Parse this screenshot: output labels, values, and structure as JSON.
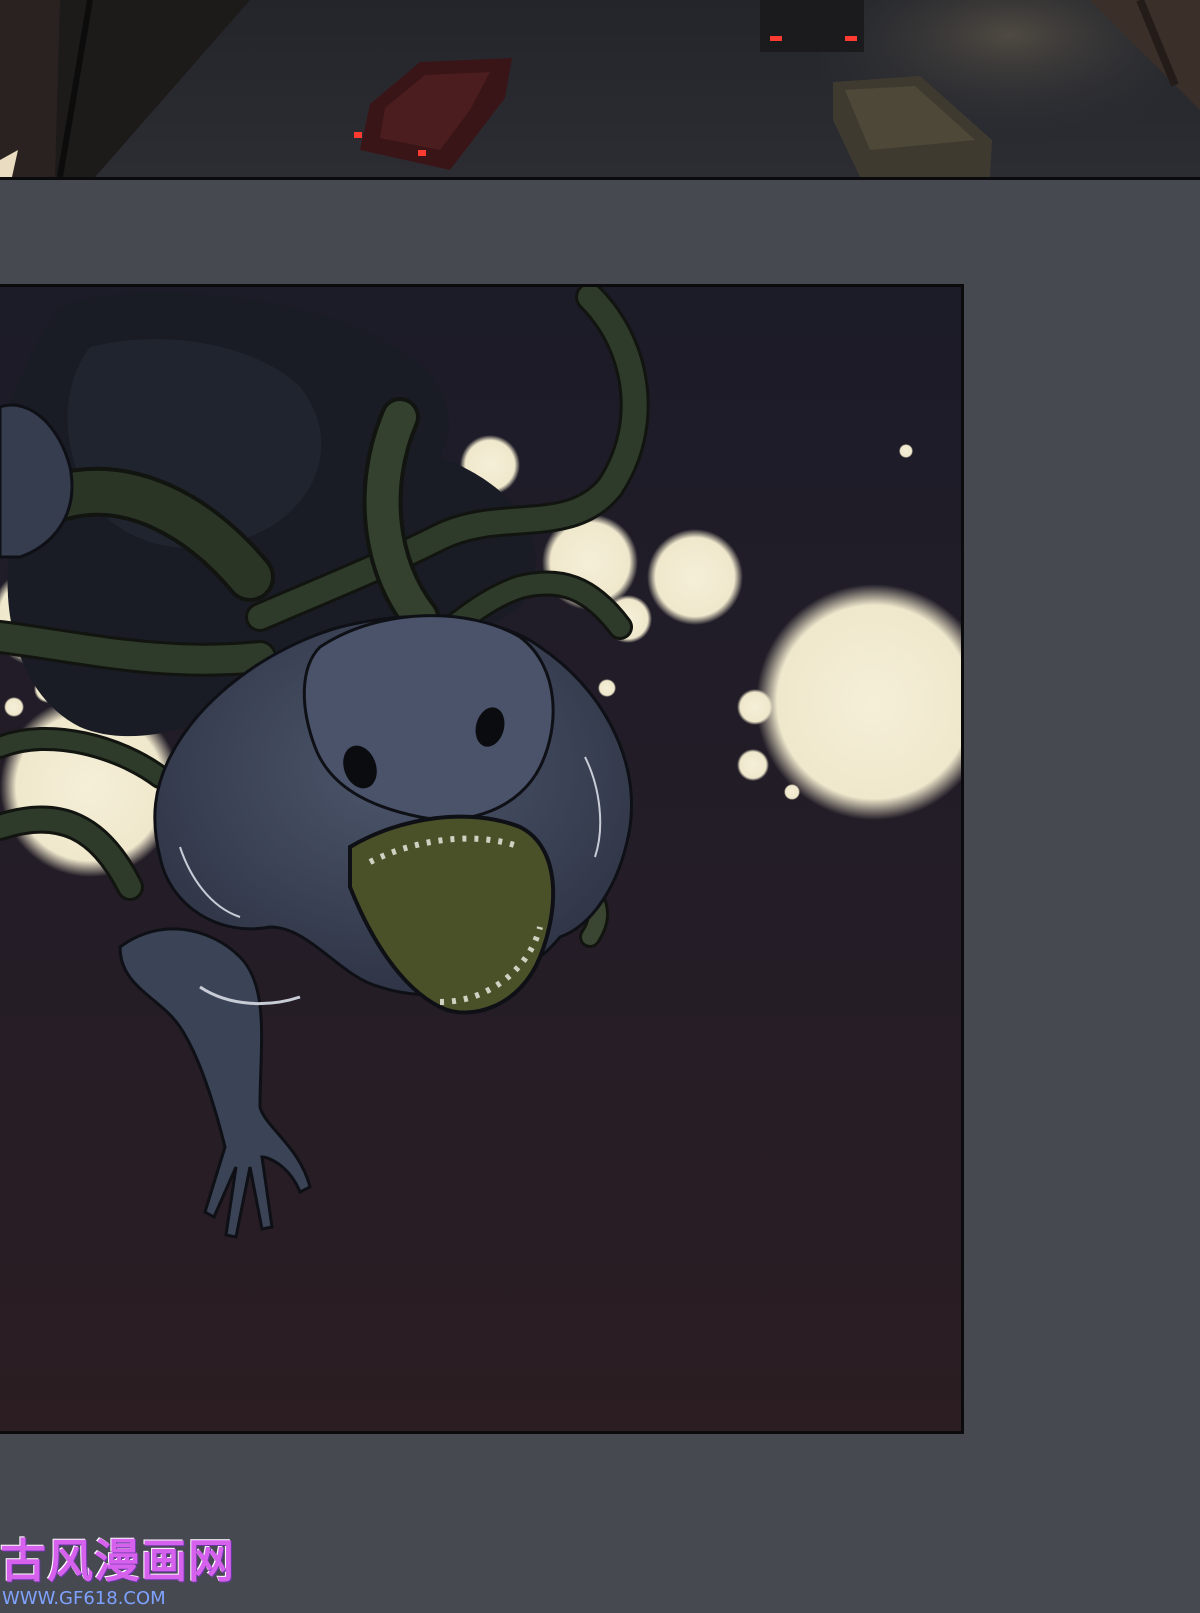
{
  "watermark": {
    "logo_text": "古风漫画网",
    "url_text": "WWW.GF618.COM"
  },
  "colors": {
    "gutter": "#464950",
    "panel_border": "#0b0b0d",
    "night_sky_top": "#1c1b28",
    "night_sky_bottom": "#2b1d22",
    "glow": "#f3ecd3",
    "creature_skin": "#434b60",
    "tentacle": "#2e3a2a",
    "mouth": "#4a5128",
    "watermark_logo": "#d561ec",
    "watermark_url": "#7fa2ff"
  },
  "icons": {
    "top_panel": "night-street-illustration",
    "main_panel": "tentacle-creature-illustration"
  }
}
